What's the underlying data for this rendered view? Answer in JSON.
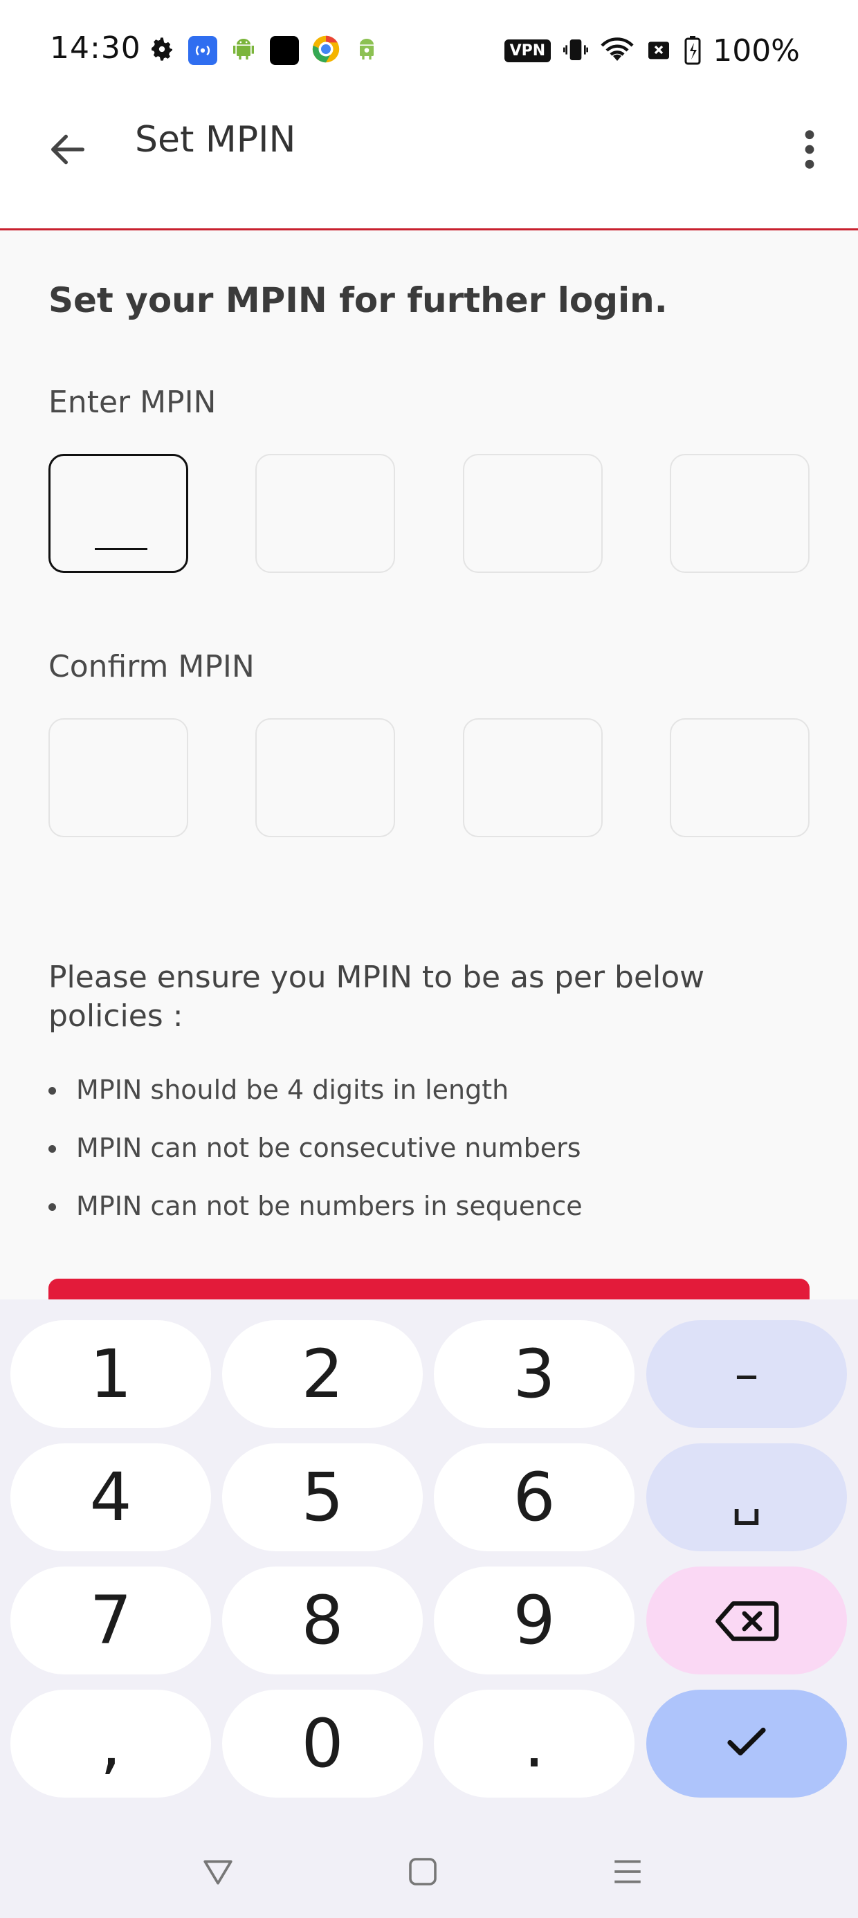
{
  "status_bar": {
    "time": "14:30",
    "vpn_label": "VPN",
    "battery_text": "100%",
    "left_icons": [
      "gear-icon",
      "broadcast-icon",
      "android-icon",
      "black-app-icon",
      "browser-icon",
      "android-icon"
    ],
    "right_icons": [
      "vpn-icon",
      "vibrate-icon",
      "wifi-icon",
      "no-sim-icon",
      "battery-icon"
    ]
  },
  "app_bar": {
    "title": "Set MPIN",
    "back_icon": "arrow-left-icon",
    "more_icon": "more-vert-icon"
  },
  "form": {
    "heading": "Set your MPIN for further login.",
    "enter_label": "Enter MPIN",
    "confirm_label": "Confirm MPIN",
    "digits": 4
  },
  "policies": {
    "intro": "Please ensure you MPIN to be as per below policies :",
    "items": [
      "MPIN should be 4 digits in length",
      "MPIN can not be consecutive numbers",
      "MPIN can not be numbers in sequence"
    ]
  },
  "keyboard": {
    "keys": {
      "k1": "1",
      "k2": "2",
      "k3": "3",
      "dash": "–",
      "k4": "4",
      "k5": "5",
      "k6": "6",
      "space": "␣",
      "k7": "7",
      "k8": "8",
      "k9": "9",
      "comma": ",",
      "k0": "0",
      "period": "."
    },
    "backspace_icon": "backspace-icon",
    "done_icon": "check-icon"
  },
  "colors": {
    "accent": "#e31b3a",
    "app_bar_divider": "#c8202e",
    "key_fn": "#dde1f8",
    "key_delete": "#fad8f4",
    "key_done": "#aec4fb"
  },
  "nav_bar": {
    "icons": [
      "nav-back-icon",
      "nav-home-icon",
      "nav-recents-icon"
    ]
  }
}
